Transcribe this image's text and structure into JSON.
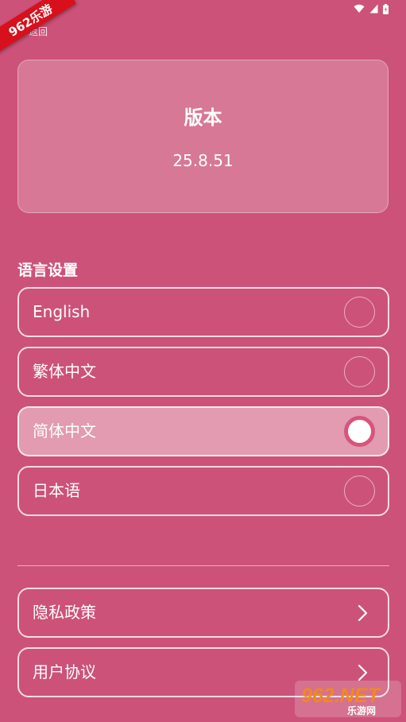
{
  "watermark": {
    "corner_text": "962乐游",
    "logo_text": "962.NET",
    "logo_subtext": "乐游网"
  },
  "header": {
    "back_label": "返回"
  },
  "version_card": {
    "title": "版本",
    "value": "25.8.51"
  },
  "language_settings": {
    "heading": "语言设置",
    "options": [
      {
        "label": "English",
        "selected": false
      },
      {
        "label": "繁体中文",
        "selected": false
      },
      {
        "label": "简体中文",
        "selected": true
      },
      {
        "label": "日本语",
        "selected": false
      }
    ]
  },
  "links": [
    {
      "label": "隐私政策"
    },
    {
      "label": "用户协议"
    }
  ],
  "colors": {
    "background": "#cc5279",
    "selected_row": "#e29bb0",
    "radio_ring": "#d6557d"
  }
}
